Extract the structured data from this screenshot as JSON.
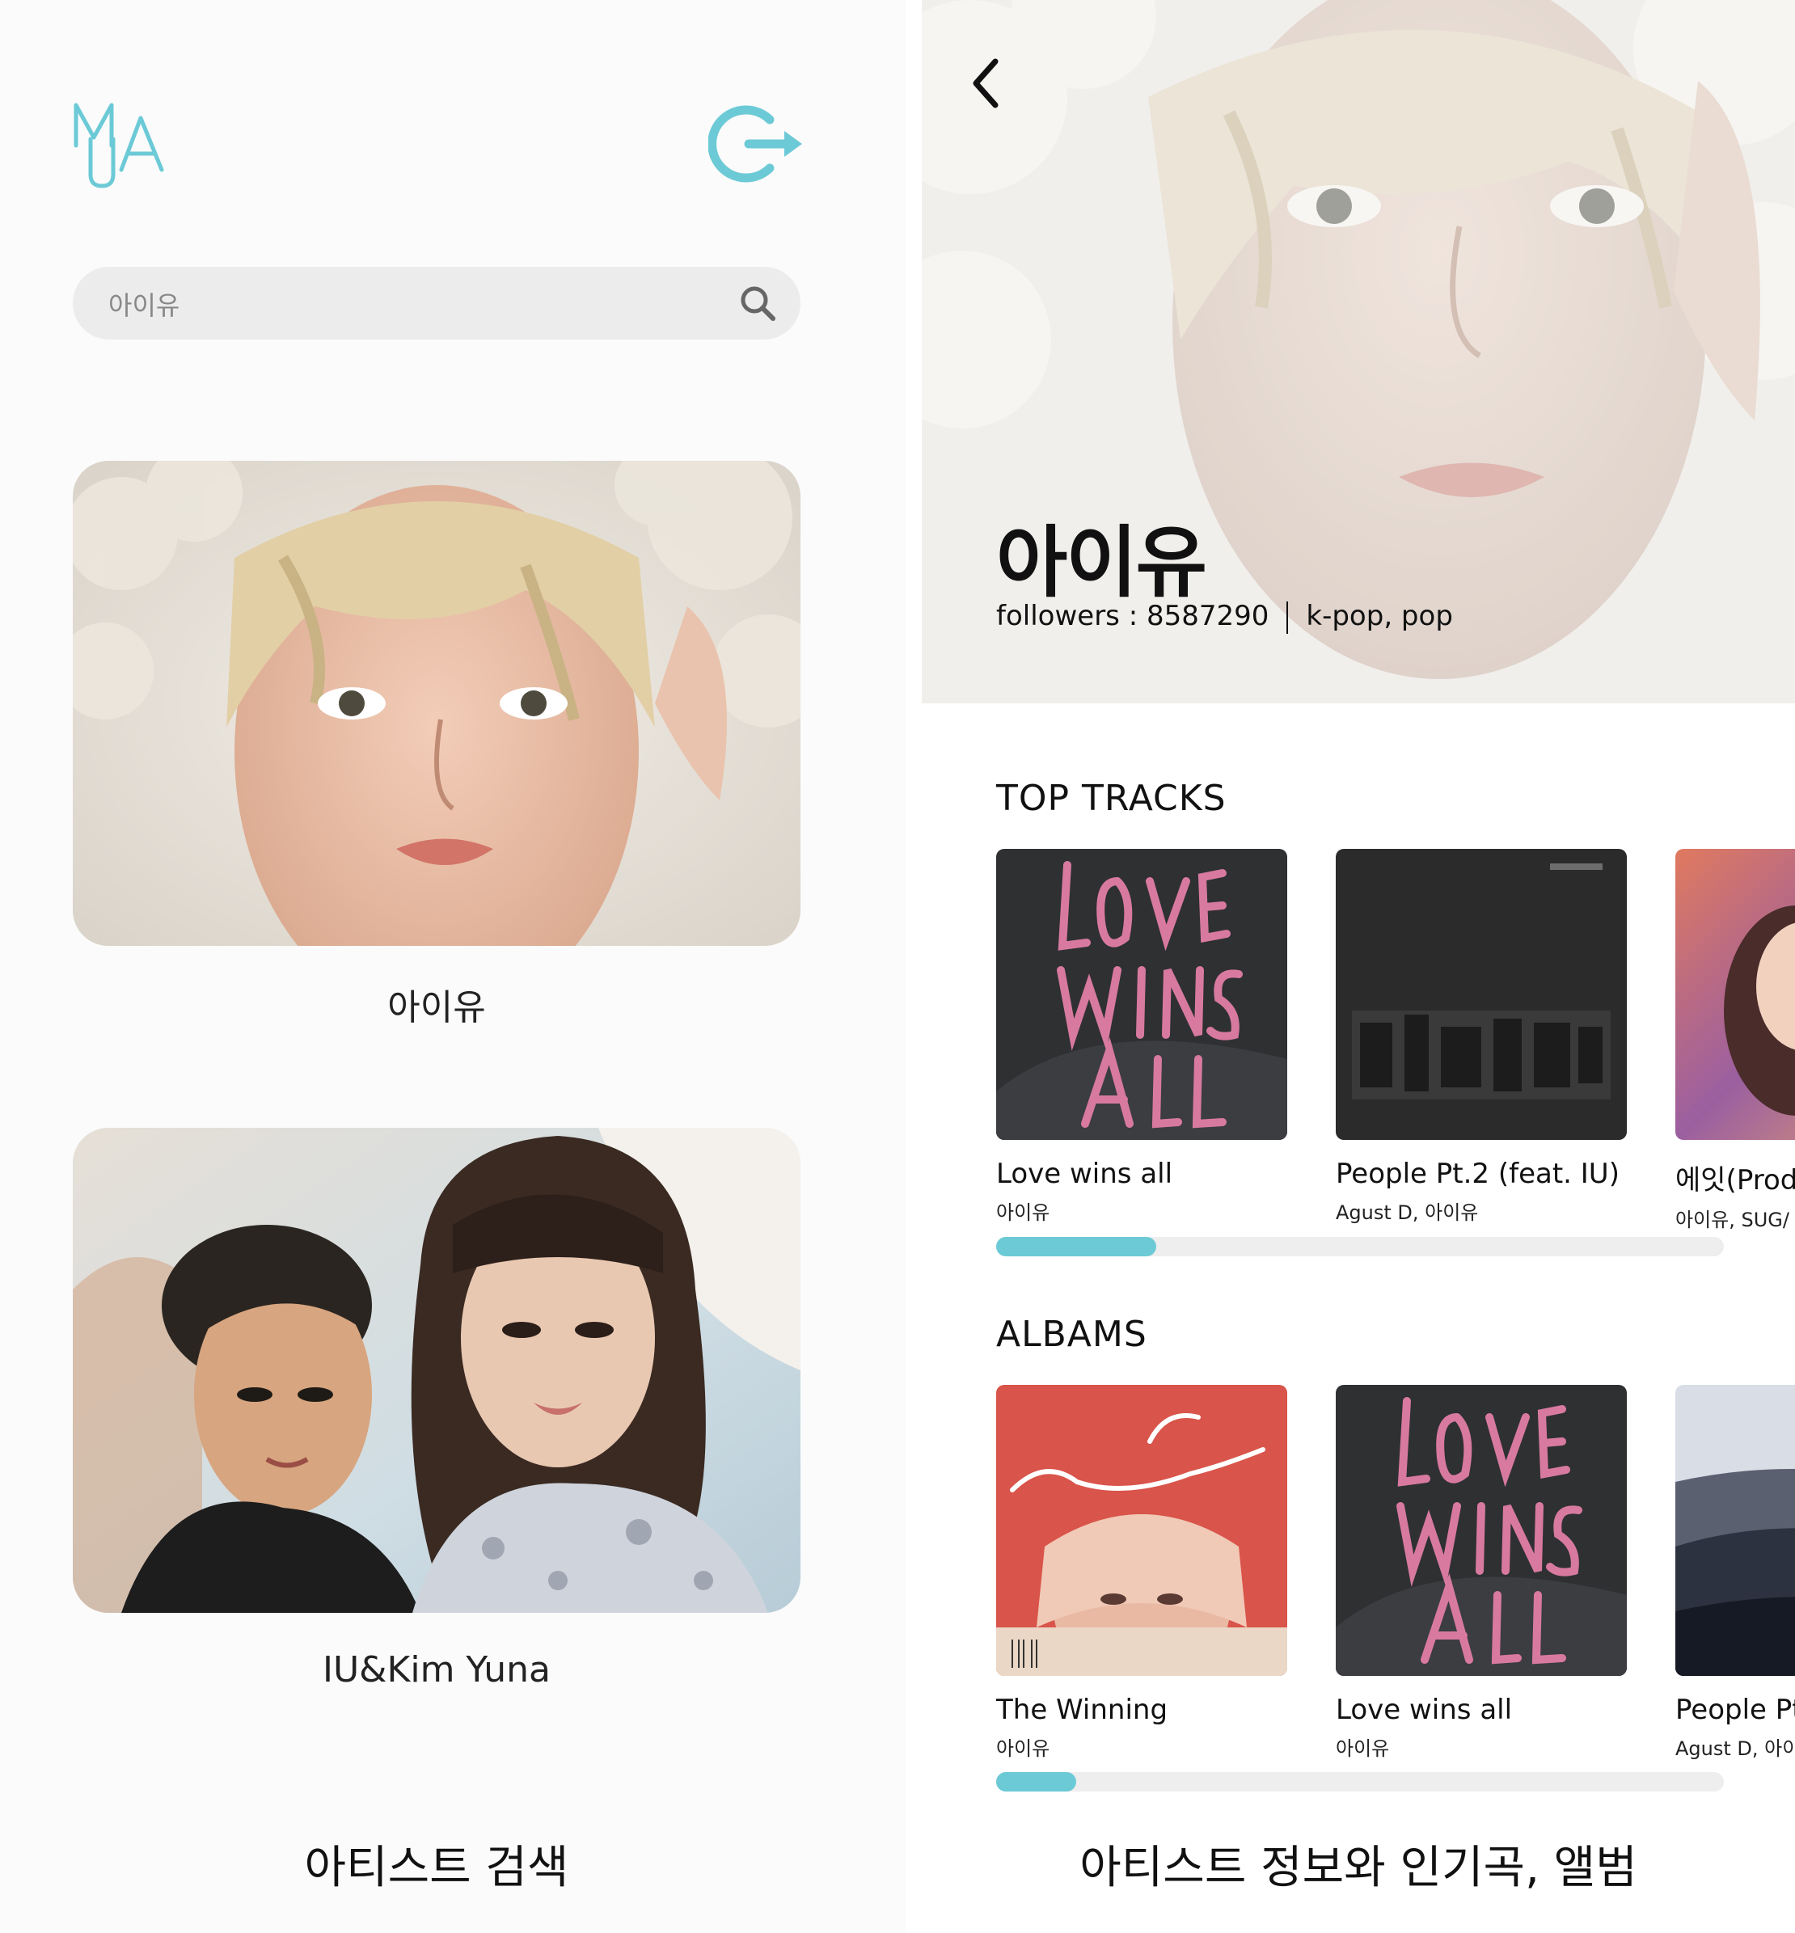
{
  "search_screen": {
    "logo_letters": [
      "M",
      "U",
      "A"
    ],
    "search": {
      "value": "아이유",
      "placeholder": ""
    },
    "results": [
      {
        "name": "아이유"
      },
      {
        "name": "IU&Kim Yuna"
      }
    ],
    "caption": "아티스트 검색"
  },
  "artist_screen": {
    "artist": {
      "name": "아이유",
      "followers_label": "followers : 8587290",
      "genres": "k-pop, pop"
    },
    "top_tracks": {
      "title": "TOP TRACKS",
      "items": [
        {
          "title": "Love wins all",
          "subtitle": "아이유"
        },
        {
          "title": "People Pt.2 (feat. IU)",
          "subtitle": "Agust D, 아이유"
        },
        {
          "title": "에잇(Prod",
          "subtitle": "아이유, SUG/"
        }
      ],
      "scroll_progress": 0.22
    },
    "albums": {
      "title": "ALBAMS",
      "items": [
        {
          "title": "The Winning",
          "subtitle": "아이유"
        },
        {
          "title": "Love wins all",
          "subtitle": "아이유"
        },
        {
          "title": "People Pt",
          "subtitle": "Agust D, 아이유"
        }
      ],
      "scroll_progress": 0.11
    },
    "caption": "아티스트 정보와 인기곡, 앨범"
  },
  "accent_color": "#6ccad6",
  "icons": [
    "logout-icon",
    "search-icon",
    "back-chevron-icon"
  ]
}
